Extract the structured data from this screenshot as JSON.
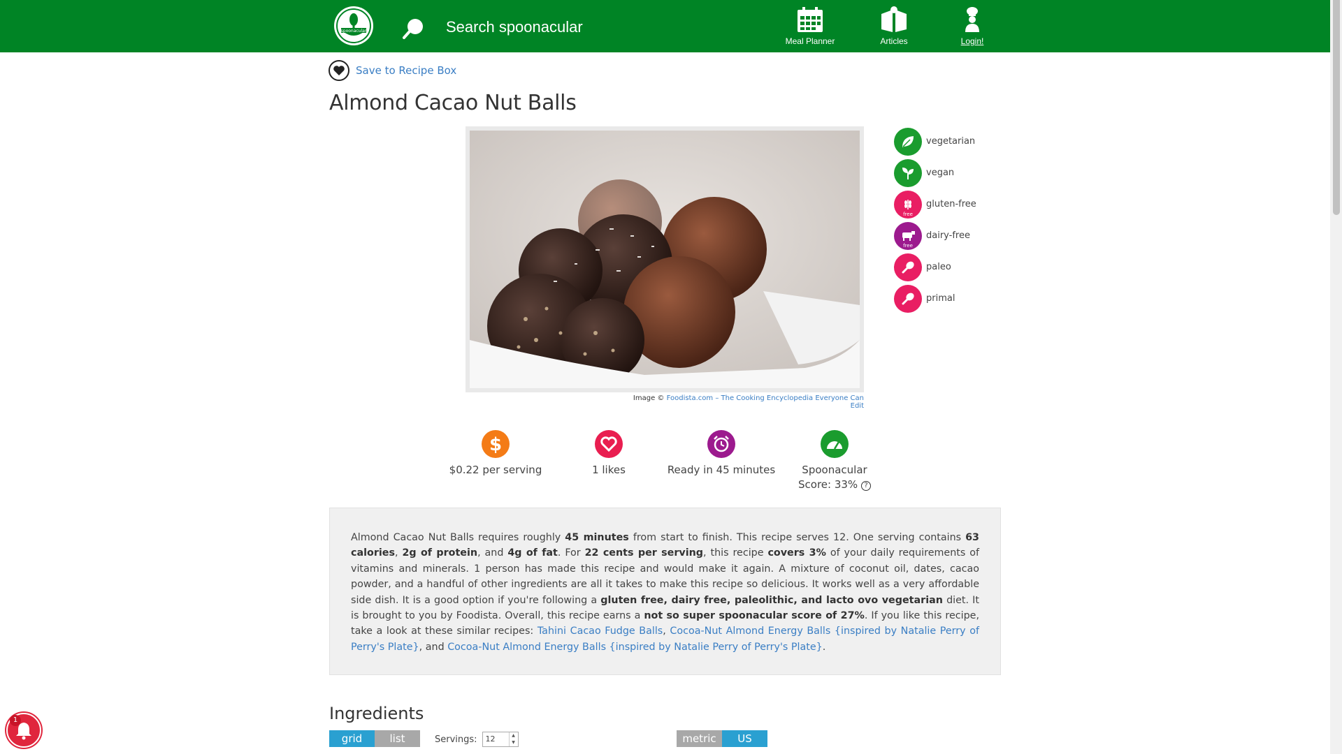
{
  "header": {
    "search_placeholder": "Search spoonacular",
    "nav": {
      "meal_planner": "Meal Planner",
      "articles": "Articles",
      "login": "Login!"
    },
    "brand_color": "#008425"
  },
  "save_label": "Save to Recipe Box",
  "title": "Almond Cacao Nut Balls",
  "image_credit": {
    "prefix": "Image ©",
    "link": "Foodista.com – The Cooking Encyclopedia Everyone Can Edit"
  },
  "diets": [
    {
      "label": "vegetarian",
      "icon": "leaf-icon",
      "color": "#1a9c2e"
    },
    {
      "label": "vegan",
      "icon": "sprout-icon",
      "color": "#1a9c2e"
    },
    {
      "label": "gluten-free",
      "icon": "wheat-free-icon",
      "color": "#e91e63",
      "badge": "free"
    },
    {
      "label": "dairy-free",
      "icon": "cow-free-icon",
      "color": "#9c1a8e",
      "badge": "free"
    },
    {
      "label": "paleo",
      "icon": "drumstick-icon",
      "color": "#e91e63"
    },
    {
      "label": "primal",
      "icon": "drumstick-icon",
      "color": "#e91e63"
    }
  ],
  "stats": {
    "price": "$0.22 per serving",
    "likes": "1 likes",
    "ready": "Ready in 45 minutes",
    "score_line1": "Spoonacular",
    "score_line2": "Score: 33%"
  },
  "summary": {
    "t1": "Almond Cacao Nut Balls requires roughly ",
    "b1": "45 minutes",
    "t2": " from start to finish. This recipe serves 12. One serving contains ",
    "b2": "63 calories",
    "t3": ", ",
    "b3": "2g of protein",
    "t4": ", and ",
    "b4": "4g of fat",
    "t5": ". For ",
    "b5": "22 cents per serving",
    "t6": ", this recipe ",
    "b6": "covers 3%",
    "t7": " of your daily requirements of vitamins and minerals. 1 person has made this recipe and would make it again. A mixture of coconut oil, dates, cacao powder, and a handful of other ingredients are all it takes to make this recipe so delicious. It works well as a very affordable side dish. It is a good option if you're following a ",
    "b7": "gluten free, dairy free, paleolithic, and lacto ovo vegetarian",
    "t8": " diet. It is brought to you by Foodista. Overall, this recipe earns a ",
    "b8": "not so super spoonacular score of 27%",
    "t9": ". If you like this recipe, take a look at these similar recipes: ",
    "l1": "Tahini Cacao Fudge Balls",
    "t10": ", ",
    "l2": "Cocoa-Nut Almond Energy Balls {inspired by Natalie Perry of Perry's Plate}",
    "t11": ", and ",
    "l3": "Cocoa-Nut Almond Energy Balls {inspired by Natalie Perry of Perry's Plate}",
    "t12": "."
  },
  "ingredients": {
    "title": "Ingredients",
    "view_grid": "grid",
    "view_list": "list",
    "servings_label": "Servings:",
    "servings_value": "12",
    "unit_metric": "metric",
    "unit_us": "US"
  },
  "notification": {
    "count": "1"
  }
}
